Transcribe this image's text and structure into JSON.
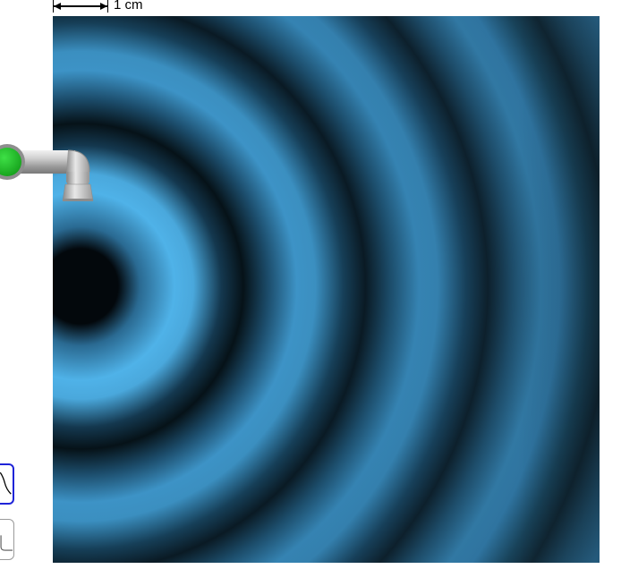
{
  "scale_bar": {
    "label": "1 cm"
  },
  "wave_area": {
    "colors": {
      "crest": "#4fb2e8",
      "trough": "#03080c",
      "mid": "#2e6f98"
    }
  },
  "faucet": {
    "button_color": "#22c22b",
    "icon": "faucet-icon"
  },
  "toggles": [
    {
      "name": "continuous-wave-toggle",
      "icon": "sine-wave-icon",
      "selected": true,
      "accent": "#1f24d8"
    },
    {
      "name": "pulse-toggle",
      "icon": "pulse-icon",
      "selected": false
    }
  ]
}
